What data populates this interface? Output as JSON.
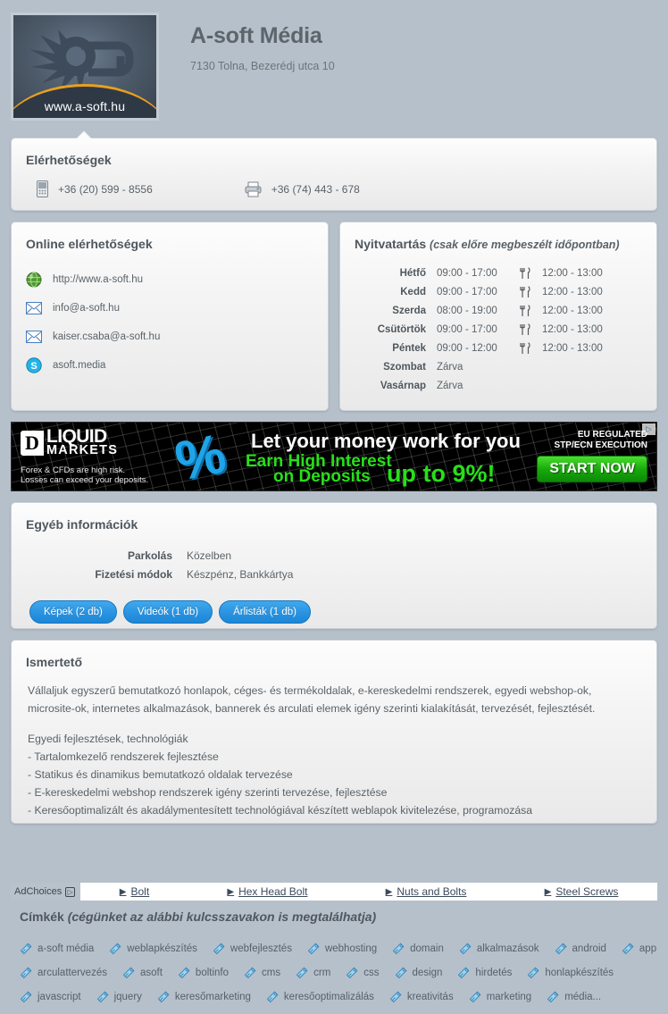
{
  "header": {
    "company_name": "A-soft Média",
    "address": "7130 Tolna, Bezerédj utca 10",
    "logo_url": "www.a-soft.hu",
    "logo_icon": "asoft-gear-logo"
  },
  "contacts": {
    "title": "Elérhetőségek",
    "items": [
      {
        "icon": "mobile-phone-icon",
        "value": "+36 (20) 599 - 8556"
      },
      {
        "icon": "fax-printer-icon",
        "value": "+36 (74) 443 - 678"
      }
    ]
  },
  "online": {
    "title": "Online elérhetőségek",
    "items": [
      {
        "icon": "globe-icon",
        "value": "http://www.a-soft.hu"
      },
      {
        "icon": "email-icon",
        "value": "info@a-soft.hu"
      },
      {
        "icon": "email-icon",
        "value": "kaiser.csaba@a-soft.hu"
      },
      {
        "icon": "skype-icon",
        "value": "asoft.media"
      }
    ]
  },
  "hours": {
    "title": "Nyitvatartás",
    "subtitle": "(csak előre megbeszélt időpontban)",
    "lunch_icon": "cutlery-icon",
    "rows": [
      {
        "day": "Hétfő",
        "open": "09:00 - 17:00",
        "lunch": "12:00 - 13:00"
      },
      {
        "day": "Kedd",
        "open": "09:00 - 17:00",
        "lunch": "12:00 - 13:00"
      },
      {
        "day": "Szerda",
        "open": "08:00 - 19:00",
        "lunch": "12:00 - 13:00"
      },
      {
        "day": "Csütörtök",
        "open": "09:00 - 17:00",
        "lunch": "12:00 - 13:00"
      },
      {
        "day": "Péntek",
        "open": "09:00 - 12:00",
        "lunch": "12:00 - 13:00"
      },
      {
        "day": "Szombat",
        "open": "Zárva",
        "lunch": ""
      },
      {
        "day": "Vasárnap",
        "open": "Zárva",
        "lunch": ""
      }
    ]
  },
  "ad": {
    "logo_letter": "D",
    "brand_line1": "LIQUID",
    "brand_line2": "MARKETS",
    "disclaimer_line1": "Forex & CFDs are high risk.",
    "disclaimer_line2": "Losses can exceed your deposits.",
    "percent_symbol": "%",
    "headline1": "Let your money work for you",
    "headline2": "Earn High Interest",
    "headline3": "on Deposits",
    "headline4": "up to 9%!",
    "regulated_line1": "EU REGULATED",
    "regulated_line2": "STP/ECN EXECUTION",
    "cta": "START NOW",
    "corner_icon": "adchoices-icon"
  },
  "other_info": {
    "title": "Egyéb információk",
    "rows": [
      {
        "label": "Parkolás",
        "value": "Közelben"
      },
      {
        "label": "Fizetési módok",
        "value": "Készpénz, Bankkártya"
      }
    ],
    "buttons": [
      {
        "label": "Képek (2 db)"
      },
      {
        "label": "Videók (1 db)"
      },
      {
        "label": "Árlisták (1 db)"
      }
    ]
  },
  "description": {
    "title": "Ismertető",
    "paragraph1": "Vállaljuk egyszerű bemutatkozó honlapok, céges- és termékoldalak, e-kereskedelmi rendszerek, egyedi webshop-ok, microsite-ok, internetes alkalmazások, bannerek és arculati elemek igény szerinti kialakítását, tervezését, fejlesztését.",
    "lines": [
      "Egyedi fejlesztések, technológiák",
      "- Tartalomkezelő rendszerek fejlesztése",
      "- Statikus és dinamikus bemutatkozó oldalak tervezése",
      "- E-kereskedelmi webshop rendszerek igény szerinti tervezése, fejlesztése",
      "- Keresőoptimalizált és akadálymentesített technológiával készített weblapok kivitelezése, programozása"
    ]
  },
  "adchoices": {
    "label": "AdChoices",
    "icon": "adchoices-icon",
    "links": [
      {
        "label": "Bolt"
      },
      {
        "label": "Hex Head Bolt"
      },
      {
        "label": "Nuts and Bolts"
      },
      {
        "label": "Steel Screws"
      }
    ]
  },
  "tags": {
    "title_plain": "Címkék ",
    "title_italic": "(cégünket az alábbi kulcsszavakon is megtalálhatja)",
    "tag_icon": "tag-label-icon",
    "lines": [
      [
        "a-soft média",
        "weblapkészítés",
        "webfejlesztés",
        "webhosting",
        "domain",
        "alkalmazások",
        "android",
        "app"
      ],
      [
        "arculattervezés",
        "asoft",
        "boltinfo",
        "cms",
        "crm",
        "css",
        "design",
        "hirdetés",
        "honlapkészítés"
      ],
      [
        "javascript",
        "jquery",
        "keresőmarketing",
        "keresőoptimalizálás",
        "kreativitás",
        "marketing",
        "média..."
      ]
    ]
  },
  "colors": {
    "page_background": "#b6c0ca",
    "panel_top": "#fdfdfd",
    "panel_bottom": "#e9e9e9",
    "heading_text": "#4f575e",
    "body_text": "#5a6268",
    "button_blue": "#2b95e2",
    "ad_green": "#27e018",
    "ad_blue": "#1fa4e8",
    "logo_orange": "#e8a020"
  }
}
